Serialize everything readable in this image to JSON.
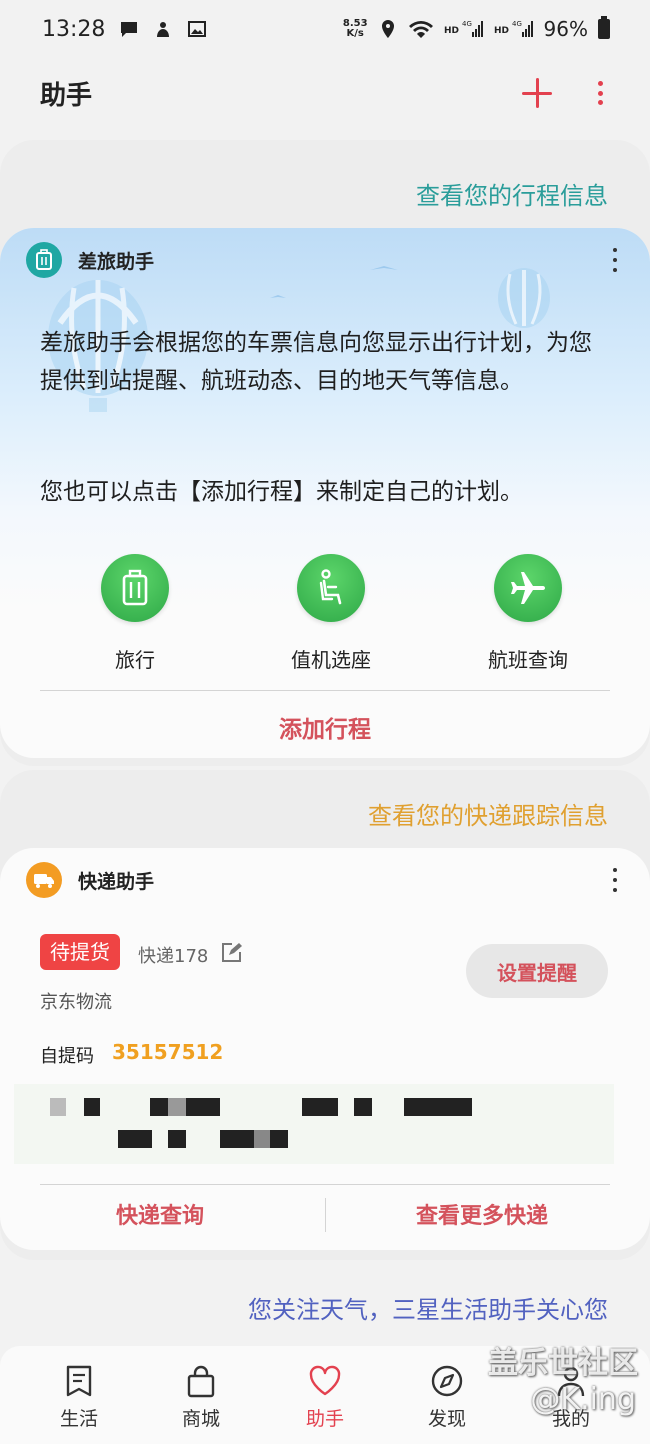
{
  "status_bar": {
    "time": "13:28",
    "net_speed_top": "8.53",
    "net_speed_bottom": "K/s",
    "battery": "96%"
  },
  "header": {
    "title": "助手",
    "add_icon": "plus-icon",
    "more_icon": "more-vertical-icon"
  },
  "travel_section": {
    "link_text": "查看您的行程信息",
    "link_color": "#2a9d9a",
    "card_name": "差旅助手",
    "description": "差旅助手会根据您的车票信息向您显示出行计划，为您提供到站提醒、航班动态、目的地天气等信息。",
    "description2": "您也可以点击【添加行程】来制定自己的计划。",
    "actions": [
      {
        "label": "旅行",
        "icon": "suitcase-icon"
      },
      {
        "label": "值机选座",
        "icon": "seat-icon"
      },
      {
        "label": "航班查询",
        "icon": "airplane-icon"
      }
    ],
    "add_button": "添加行程"
  },
  "delivery_section": {
    "link_text": "查看您的快递跟踪信息",
    "link_color": "#e0a030",
    "card_name": "快递助手",
    "status_badge": "待提货",
    "courier": "快递178",
    "remind_button": "设置提醒",
    "company": "京东物流",
    "pickup_label": "自提码",
    "pickup_code": "35157512",
    "query_button": "快递查询",
    "more_button": "查看更多快递"
  },
  "weather_section": {
    "link_text": "您关注天气，三星生活助手关心您"
  },
  "bottom_nav": {
    "items": [
      {
        "label": "生活",
        "icon": "book-icon"
      },
      {
        "label": "商城",
        "icon": "shopping-bag-icon"
      },
      {
        "label": "助手",
        "icon": "heart-icon",
        "active": true
      },
      {
        "label": "发现",
        "icon": "compass-icon"
      },
      {
        "label": "我的",
        "icon": "person-icon"
      }
    ]
  },
  "watermark": {
    "line1": "盖乐世社区",
    "line2": "@K.ing"
  },
  "colors": {
    "accent": "#e3414f",
    "button_text": "#d4525c",
    "green": "#3cb857",
    "code": "#f0a020"
  }
}
